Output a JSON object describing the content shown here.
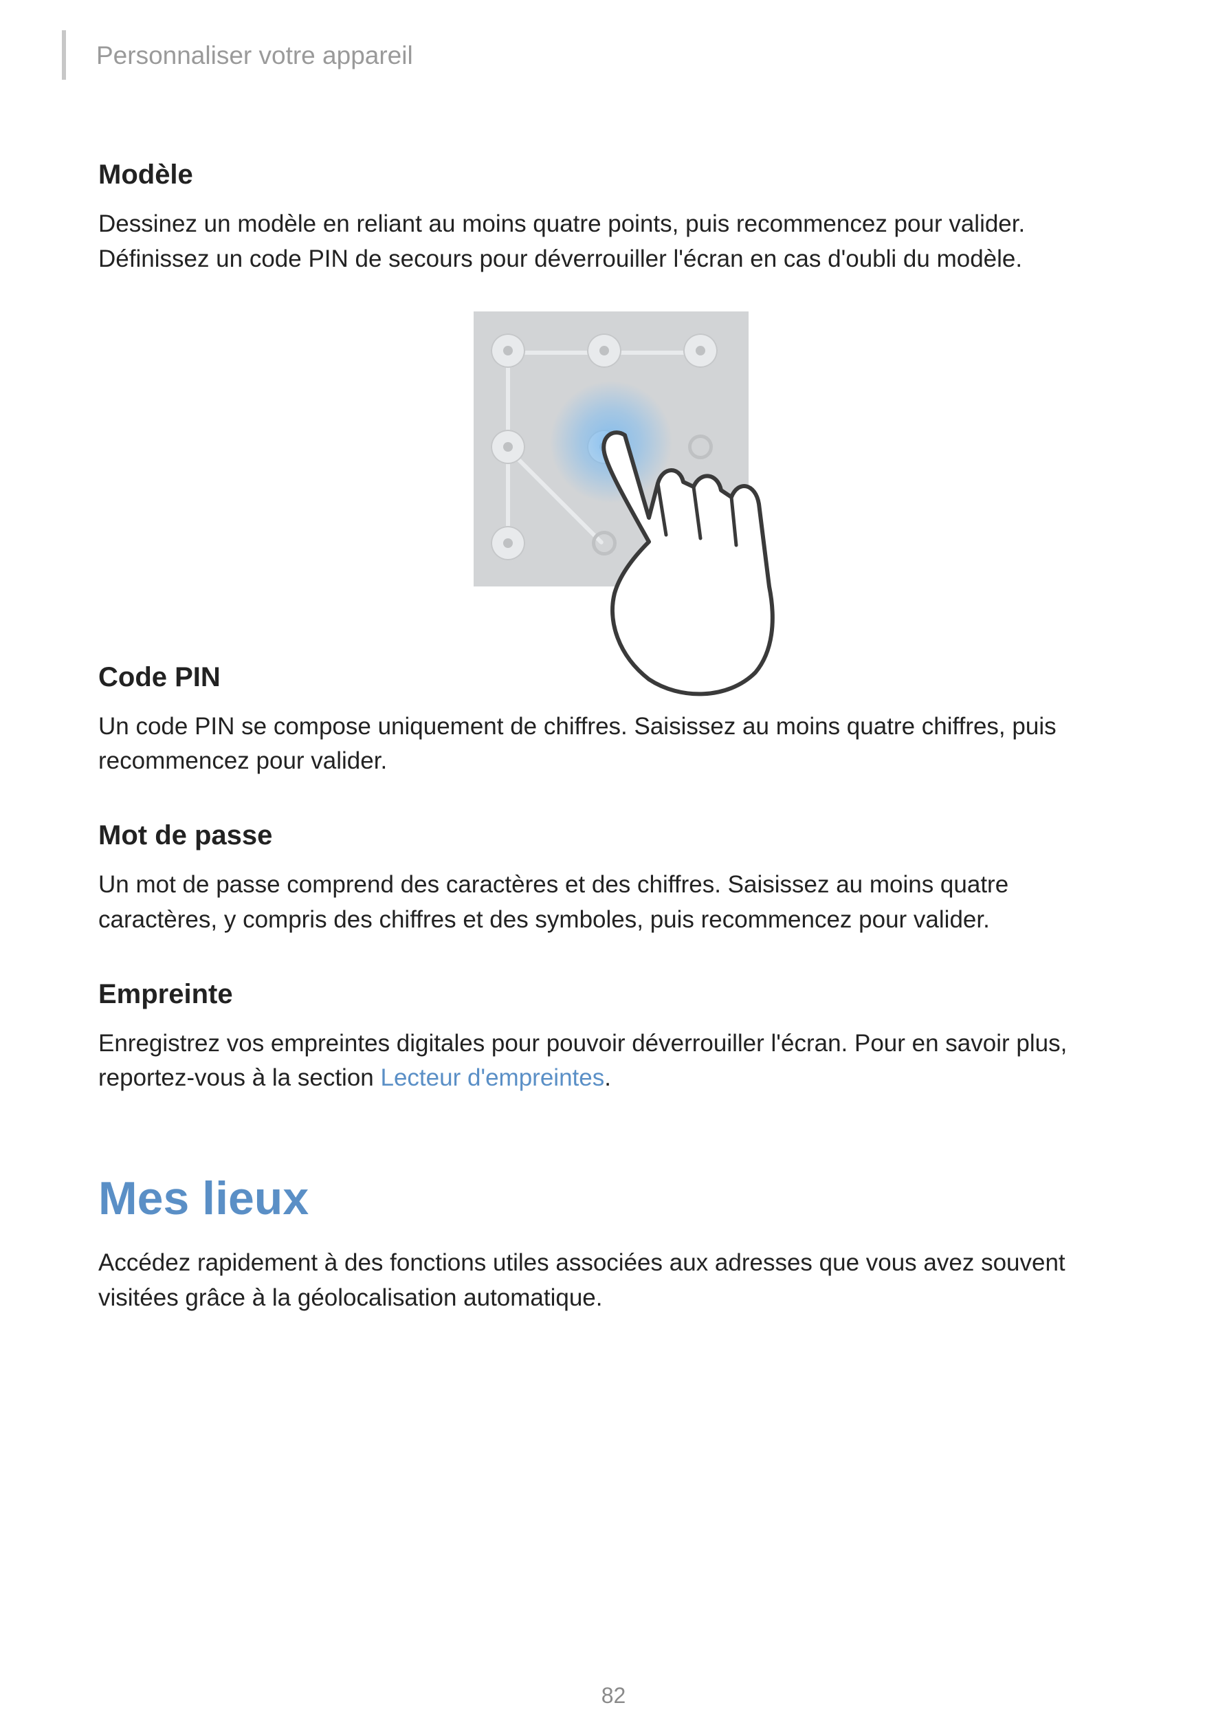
{
  "header": "Personnaliser votre appareil",
  "sections": {
    "modele": {
      "title": "Modèle",
      "body": "Dessinez un modèle en reliant au moins quatre points, puis recommencez pour valider. Définissez un code PIN de secours pour déverrouiller l'écran en cas d'oubli du modèle."
    },
    "codepin": {
      "title": "Code PIN",
      "body": "Un code PIN se compose uniquement de chiffres. Saisissez au moins quatre chiffres, puis recommencez pour valider."
    },
    "motdepasse": {
      "title": "Mot de passe",
      "body": "Un mot de passe comprend des caractères et des chiffres. Saisissez au moins quatre caractères, y compris des chiffres et des symboles, puis recommencez pour valider."
    },
    "empreinte": {
      "title": "Empreinte",
      "body_pre": "Enregistrez vos empreintes digitales pour pouvoir déverrouiller l'écran. Pour en savoir plus, reportez-vous à la section ",
      "link": "Lecteur d'empreintes",
      "body_post": "."
    }
  },
  "major": {
    "title": "Mes lieux",
    "body": "Accédez rapidement à des fonctions utiles associées aux adresses que vous avez souvent visitées grâce à la géolocalisation automatique."
  },
  "page_number": "82"
}
